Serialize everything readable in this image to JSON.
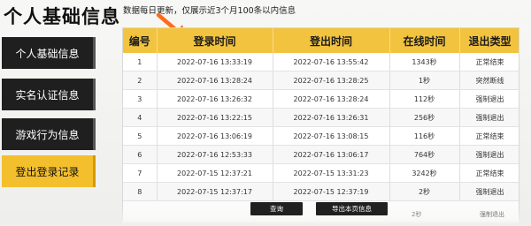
{
  "page": {
    "title": "个人基础信息",
    "notice": "数据每日更新，仅展示近3个月100条以内信息"
  },
  "sidebar": {
    "items": [
      {
        "label": "个人基础信息",
        "active": false
      },
      {
        "label": "实名认证信息",
        "active": false
      },
      {
        "label": "游戏行为信息",
        "active": false
      },
      {
        "label": "登出登录记录",
        "active": true
      }
    ]
  },
  "table": {
    "headers": [
      "编号",
      "登录时间",
      "登出时间",
      "在线时间",
      "退出类型"
    ],
    "rows": [
      {
        "id": "1",
        "login": "2022-07-16 13:33:19",
        "logout": "2022-07-16 13:55:42",
        "online": "1343秒",
        "type": "正常结束"
      },
      {
        "id": "2",
        "login": "2022-07-16 13:28:24",
        "logout": "2022-07-16 13:28:25",
        "online": "1秒",
        "type": "突然断线"
      },
      {
        "id": "3",
        "login": "2022-07-16 13:26:32",
        "logout": "2022-07-16 13:28:24",
        "online": "112秒",
        "type": "强制退出"
      },
      {
        "id": "4",
        "login": "2022-07-16 13:22:15",
        "logout": "2022-07-16 13:26:31",
        "online": "256秒",
        "type": "强制退出"
      },
      {
        "id": "5",
        "login": "2022-07-16 13:06:19",
        "logout": "2022-07-16 13:08:15",
        "online": "116秒",
        "type": "正常结束"
      },
      {
        "id": "6",
        "login": "2022-07-16 12:53:33",
        "logout": "2022-07-16 13:06:17",
        "online": "764秒",
        "type": "强制退出"
      },
      {
        "id": "7",
        "login": "2022-07-15 12:37:21",
        "logout": "2022-07-15 13:31:23",
        "online": "3242秒",
        "type": "正常结束"
      },
      {
        "id": "8",
        "login": "2022-07-15 12:37:17",
        "logout": "2022-07-15 12:37:19",
        "online": "2秒",
        "type": "强制退出"
      }
    ]
  },
  "actions": {
    "query": "查询",
    "export": "导出本页信息"
  },
  "partial_text": {
    "row8_online_hint": "2秒",
    "bottom_hint": "强制退出"
  },
  "colors": {
    "accent": "#f2c33f",
    "arrow": "#ff6b1a",
    "sidebar_bg": "#1f1f1f",
    "active_sidebar_bg": "#f3bf2d"
  }
}
